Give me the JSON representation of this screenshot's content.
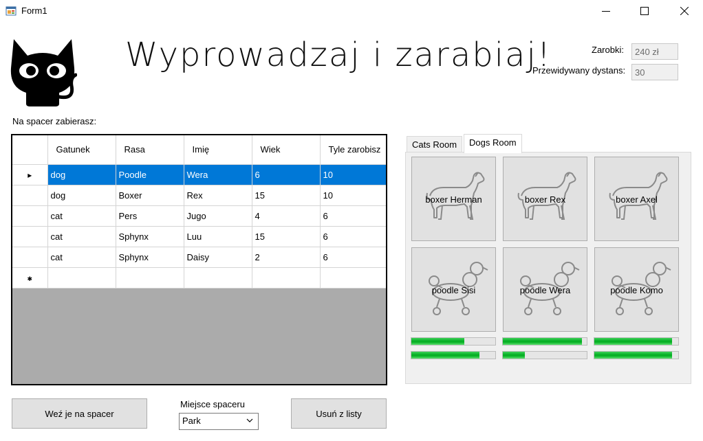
{
  "window": {
    "title": "Form1",
    "icon": "winforms-form-icon",
    "controls": [
      "minimize-icon",
      "maximize-icon",
      "close-icon"
    ]
  },
  "header": {
    "logo_icon": "black-cat-icon",
    "title": "Wyprowadzaj i zarabiaj!",
    "earnings_label": "Zarobki:",
    "earnings_value": "240 zł",
    "distance_label": "Przewidywany dystans:",
    "distance_value": "30"
  },
  "grid": {
    "caption": "Na spacer zabierasz:",
    "columns": [
      "Gatunek",
      "Rasa",
      "Imię",
      "Wiek",
      "Tyle zarobisz"
    ],
    "rows": [
      {
        "selected": true,
        "cells": [
          "dog",
          "Poodle",
          "Wera",
          "6",
          "10"
        ]
      },
      {
        "selected": false,
        "cells": [
          "dog",
          "Boxer",
          "Rex",
          "15",
          "10"
        ]
      },
      {
        "selected": false,
        "cells": [
          "cat",
          "Pers",
          "Jugo",
          "4",
          "6"
        ]
      },
      {
        "selected": false,
        "cells": [
          "cat",
          "Sphynx",
          "Luu",
          "15",
          "6"
        ]
      },
      {
        "selected": false,
        "cells": [
          "cat",
          "Sphynx",
          "Daisy",
          "2",
          "6"
        ]
      }
    ],
    "current_row_marker": "▸",
    "new_row_marker": "✱",
    "colors": {
      "selection": "#0078d7",
      "empty_area": "#ababab"
    }
  },
  "actions": {
    "take_label": "Weź je na spacer",
    "place_label": "Miejsce spaceru",
    "place_value": "Park",
    "remove_label": "Usuń z listy"
  },
  "tabs": {
    "items": [
      "Cats Room",
      "Dogs Room"
    ],
    "active": "Dogs Room",
    "dogs": [
      {
        "label": "boxer Herman",
        "icon": "boxer-dog-icon"
      },
      {
        "label": "boxer Rex",
        "icon": "boxer-dog-icon"
      },
      {
        "label": "boxer Axel",
        "icon": "boxer-dog-icon"
      },
      {
        "label": "poodle Sisi",
        "icon": "poodle-dog-icon"
      },
      {
        "label": "poodle Wera",
        "icon": "poodle-dog-icon"
      },
      {
        "label": "poodle Komo",
        "icon": "poodle-dog-icon"
      }
    ],
    "progress": [
      {
        "fraction": 0.63
      },
      {
        "fraction": 0.94
      },
      {
        "fraction": 0.93
      },
      {
        "fraction": 0.81
      },
      {
        "fraction": 0.26
      },
      {
        "fraction": 0.93
      }
    ],
    "progress_color": "#06b025"
  }
}
